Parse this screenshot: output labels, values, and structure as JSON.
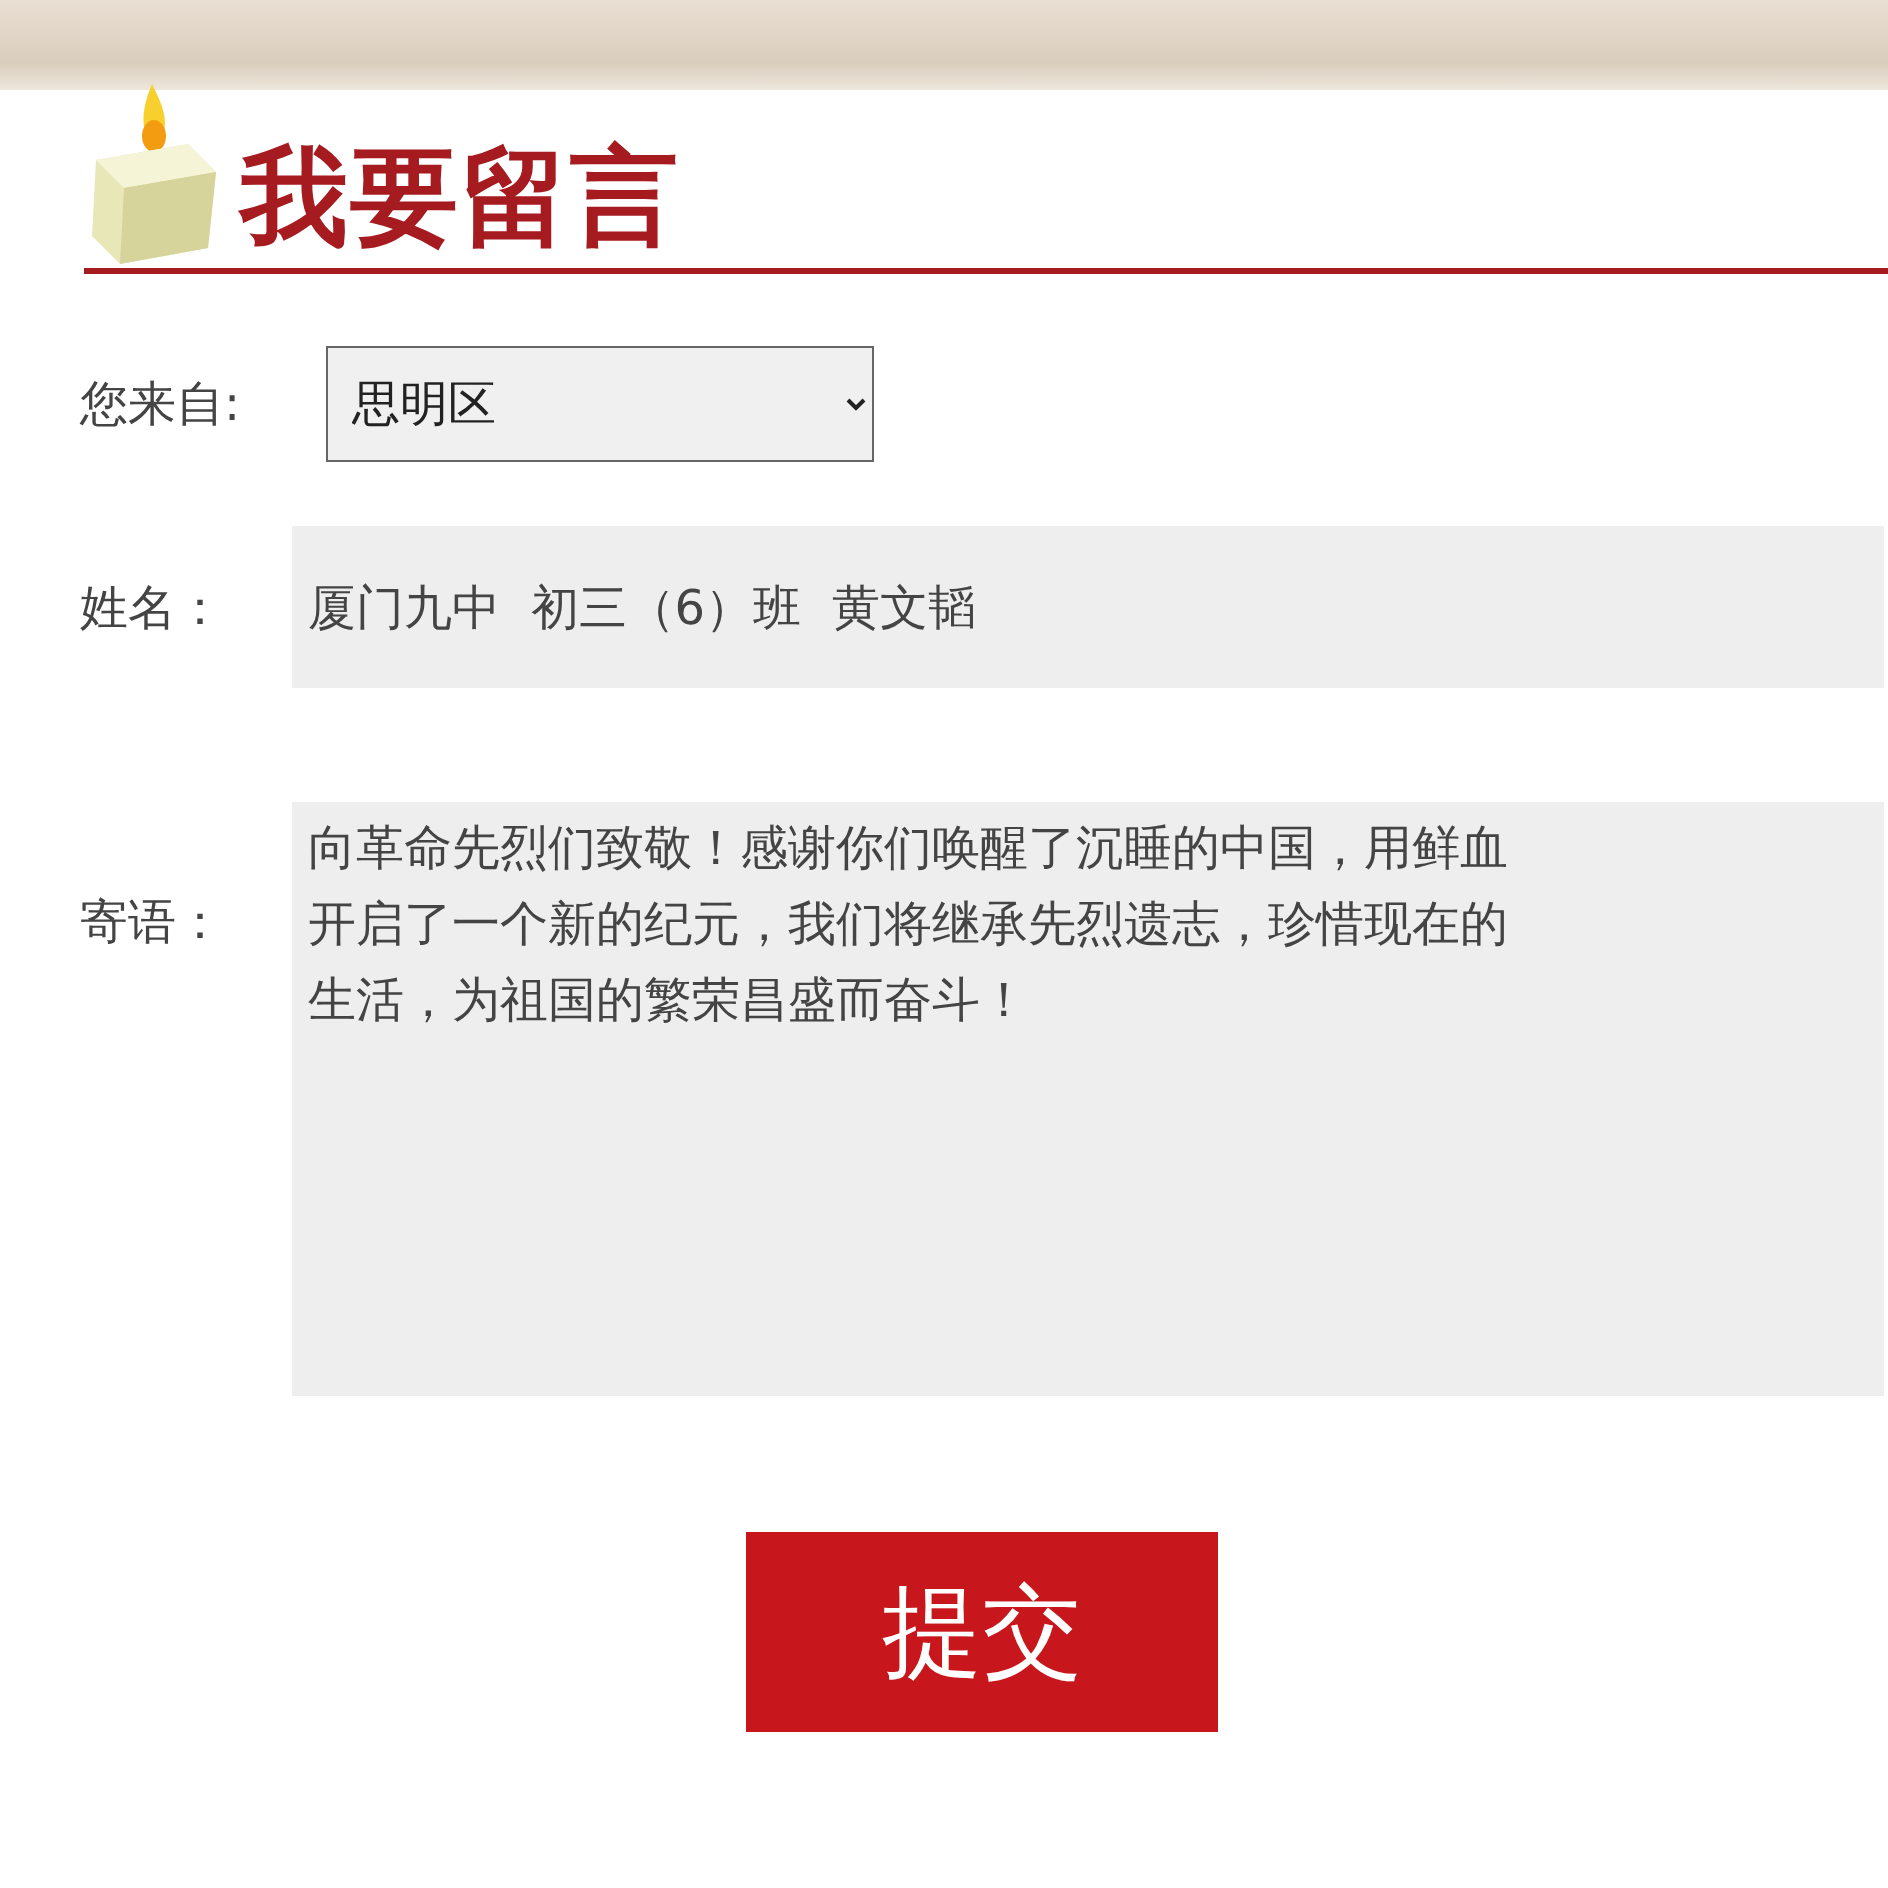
{
  "heading": {
    "title": "我要留言"
  },
  "form": {
    "region": {
      "label": "您来自:",
      "value": "思明区"
    },
    "name": {
      "label": "姓名：",
      "value": "厦门九中  初三（6）班  黄文韬"
    },
    "message": {
      "label": "寄语：",
      "lines": [
        "向革命先烈们致敬！感谢你们唤醒了沉睡的中国，用鲜血",
        "开启了一个新的纪元，我们将继承先烈遗志，珍惜现在的",
        "生活，为祖国的繁荣昌盛而奋斗！"
      ]
    }
  },
  "buttons": [
    {
      "label": "提交"
    }
  ]
}
